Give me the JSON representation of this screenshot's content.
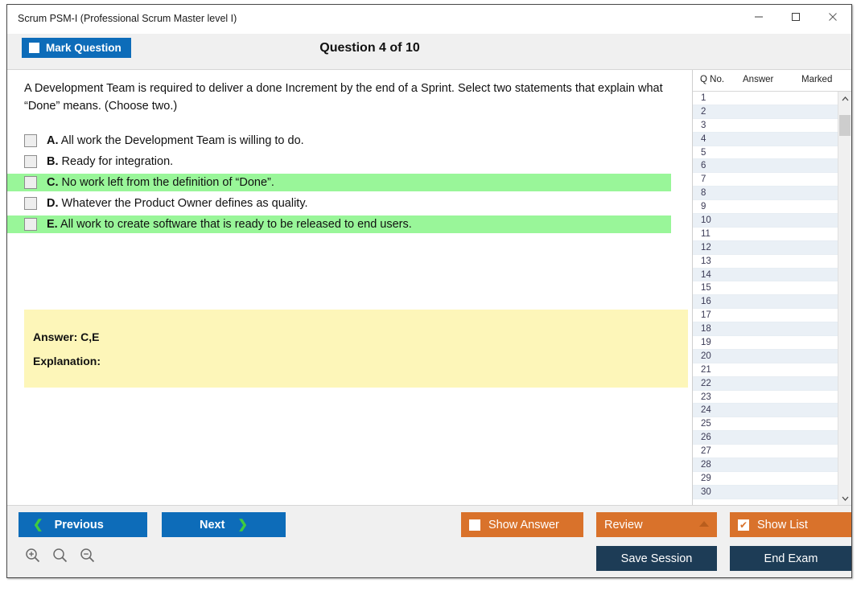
{
  "window": {
    "title": "Scrum PSM-I (Professional Scrum Master level I)",
    "minimize_label": "Minimize",
    "maximize_label": "Maximize",
    "close_label": "Close"
  },
  "header": {
    "mark_question_label": "Mark Question",
    "question_counter": "Question 4 of 10",
    "current_question": 4,
    "total_questions": 10
  },
  "question": {
    "text": "A Development Team is required to deliver a done Increment by the end of a Sprint. Select two statements that explain what “Done” means. (Choose two.)",
    "options": [
      {
        "letter": "A.",
        "text": "All work the Development Team is willing to do.",
        "correct": false,
        "checked": false
      },
      {
        "letter": "B.",
        "text": "Ready for integration.",
        "correct": false,
        "checked": false
      },
      {
        "letter": "C.",
        "text": "No work left from the definition of “Done”.",
        "correct": true,
        "checked": false
      },
      {
        "letter": "D.",
        "text": "Whatever the Product Owner defines as quality.",
        "correct": false,
        "checked": false
      },
      {
        "letter": "E.",
        "text": "All work to create software that is ready to be released to end users.",
        "correct": true,
        "checked": false
      }
    ]
  },
  "answer_box": {
    "answer_label": "Answer: C,E",
    "explanation_label": "Explanation:",
    "explanation_text": "",
    "background_color": "#fdf6b9"
  },
  "list_panel": {
    "columns": [
      "Q No.",
      "Answer",
      "Marked"
    ],
    "rows": [
      {
        "qno": "1",
        "answer": "",
        "marked": ""
      },
      {
        "qno": "2",
        "answer": "",
        "marked": ""
      },
      {
        "qno": "3",
        "answer": "",
        "marked": ""
      },
      {
        "qno": "4",
        "answer": "",
        "marked": ""
      },
      {
        "qno": "5",
        "answer": "",
        "marked": ""
      },
      {
        "qno": "6",
        "answer": "",
        "marked": ""
      },
      {
        "qno": "7",
        "answer": "",
        "marked": ""
      },
      {
        "qno": "8",
        "answer": "",
        "marked": ""
      },
      {
        "qno": "9",
        "answer": "",
        "marked": ""
      },
      {
        "qno": "10",
        "answer": "",
        "marked": ""
      },
      {
        "qno": "11",
        "answer": "",
        "marked": ""
      },
      {
        "qno": "12",
        "answer": "",
        "marked": ""
      },
      {
        "qno": "13",
        "answer": "",
        "marked": ""
      },
      {
        "qno": "14",
        "answer": "",
        "marked": ""
      },
      {
        "qno": "15",
        "answer": "",
        "marked": ""
      },
      {
        "qno": "16",
        "answer": "",
        "marked": ""
      },
      {
        "qno": "17",
        "answer": "",
        "marked": ""
      },
      {
        "qno": "18",
        "answer": "",
        "marked": ""
      },
      {
        "qno": "19",
        "answer": "",
        "marked": ""
      },
      {
        "qno": "20",
        "answer": "",
        "marked": ""
      },
      {
        "qno": "21",
        "answer": "",
        "marked": ""
      },
      {
        "qno": "22",
        "answer": "",
        "marked": ""
      },
      {
        "qno": "23",
        "answer": "",
        "marked": ""
      },
      {
        "qno": "24",
        "answer": "",
        "marked": ""
      },
      {
        "qno": "25",
        "answer": "",
        "marked": ""
      },
      {
        "qno": "26",
        "answer": "",
        "marked": ""
      },
      {
        "qno": "27",
        "answer": "",
        "marked": ""
      },
      {
        "qno": "28",
        "answer": "",
        "marked": ""
      },
      {
        "qno": "29",
        "answer": "",
        "marked": ""
      },
      {
        "qno": "30",
        "answer": "",
        "marked": ""
      }
    ]
  },
  "footer": {
    "previous_label": "Previous",
    "next_label": "Next",
    "show_answer_label": "Show Answer",
    "show_answer_checked": false,
    "review_label": "Review",
    "show_list_label": "Show List",
    "show_list_checked": true,
    "show_list_check_glyph": "✔",
    "save_session_label": "Save Session",
    "end_exam_label": "End Exam",
    "zoom_in_label": "Zoom In",
    "zoom_reset_label": "Zoom Reset",
    "zoom_out_label": "Zoom Out"
  },
  "colors": {
    "primary_blue": "#0d6cb9",
    "accent_orange": "#d9722b",
    "dark_navy": "#1d3c56",
    "correct_green": "#99f699",
    "answer_yellow": "#fdf6b9",
    "chevron_green": "#3fcb3f"
  }
}
